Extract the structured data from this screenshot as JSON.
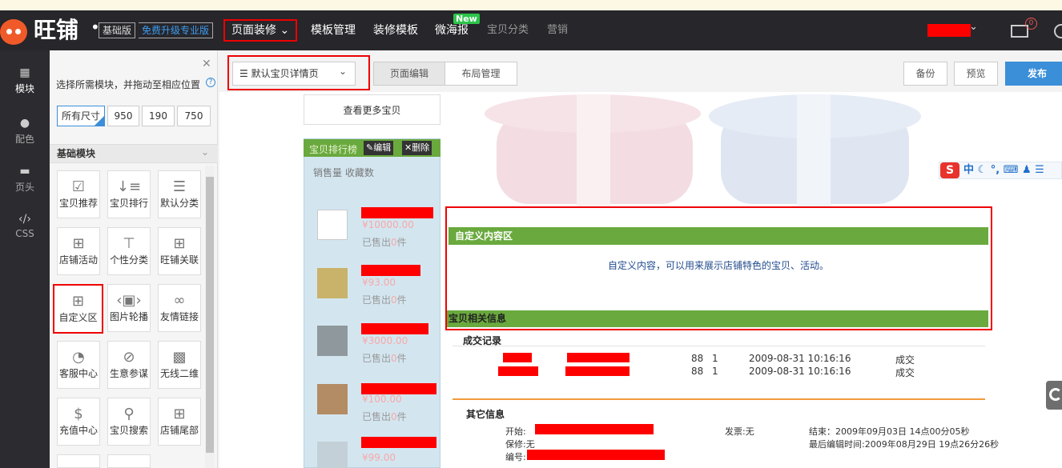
{
  "nav": {
    "brand": "旺铺",
    "edition": "基础版",
    "upgrade": "免费升级专业版",
    "items": [
      "页面装修",
      "模板管理",
      "装修模板",
      "微海报",
      "宝贝分类",
      "营销"
    ],
    "new_badge": "New",
    "mail_count": "0"
  },
  "rail": [
    "模块",
    "配色",
    "页头",
    "CSS"
  ],
  "panel": {
    "tip": "选择所需模块，并拖动至相应位置",
    "sizes": [
      "所有尺寸",
      "950",
      "190",
      "750"
    ],
    "section": "基础模块",
    "tiles": [
      "宝贝推荐",
      "宝贝排行",
      "默认分类",
      "店铺活动",
      "个性分类",
      "旺铺关联",
      "自定义区",
      "图片轮播",
      "友情链接",
      "客服中心",
      "生意参谋",
      "无线二维",
      "充值中心",
      "宝贝搜索",
      "店铺尾部"
    ]
  },
  "toolbar": {
    "page_select": "默认宝贝详情页",
    "page_edit": "页面编辑",
    "layout_manage": "布局管理",
    "backup": "备份",
    "preview": "预览",
    "publish": "发布"
  },
  "page": {
    "more": "查看更多宝贝",
    "rank_title": "宝贝排行榜",
    "edit": "编辑",
    "delete": "删除",
    "rank_tabs": "销售量  收藏数",
    "products": [
      {
        "price": "¥10000.00",
        "sold_prefix": "已售出",
        "sold_count": "0",
        "sold_suffix": "件"
      },
      {
        "price": "¥93.00",
        "sold_prefix": "已售出",
        "sold_count": "0",
        "sold_suffix": "件"
      },
      {
        "price": "¥3000.00",
        "sold_prefix": "已售出",
        "sold_count": "0",
        "sold_suffix": "件"
      },
      {
        "price": "¥100.00",
        "sold_prefix": "已售出",
        "sold_count": "0",
        "sold_suffix": "件"
      },
      {
        "price": "¥99.00"
      }
    ],
    "custom_head": "自定义内容区",
    "custom_text": "自定义内容，可以用来展示店铺特色的宝贝、活动。",
    "info_head": "宝贝相关信息",
    "deal_title": "成交记录",
    "deals": [
      {
        "qty": "88",
        "n": "1",
        "time": "2009-08-31 10:16:16",
        "status": "成交"
      },
      {
        "qty": "88",
        "n": "1",
        "time": "2009-08-31 10:16:16",
        "status": "成交"
      }
    ],
    "other_title": "其它信息",
    "start_label": "开始:",
    "invoice": "发票:无",
    "end": "结束：2009年09月03日  14点00分05秒",
    "warranty": "保修:无",
    "last_edit": "最后编辑时间:2009年08月29日  19点26分26秒",
    "code_label": "编号:"
  },
  "ime": "中",
  "colors": {
    "nav_bg": "#26262b",
    "accent": "#3b8ed8",
    "green_bar": "#6aa93e",
    "highlight": "#ee0000"
  }
}
